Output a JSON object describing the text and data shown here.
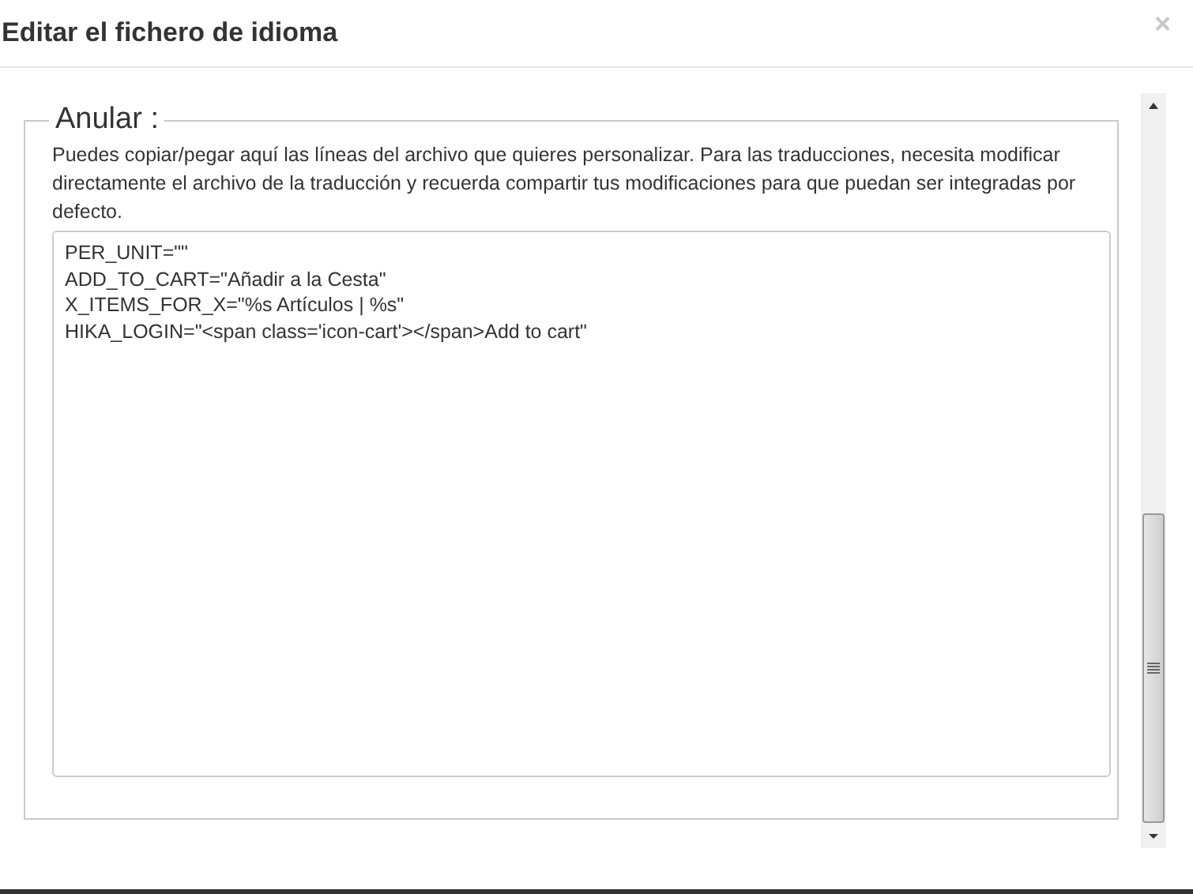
{
  "dialog": {
    "title": "Editar el fichero de idioma",
    "close": "×"
  },
  "fieldset": {
    "legend": "Anular :",
    "description": "Puedes copiar/pegar aquí las líneas del archivo que quieres personalizar. Para las traducciones, necesita modificar directamente el archivo de la traducción y recuerda compartir tus modificaciones para que puedan ser integradas por defecto.",
    "lines": [
      "PER_UNIT=\"\"",
      "ADD_TO_CART=\"Añadir a la Cesta\"",
      "X_ITEMS_FOR_X=\"%s Artículos | %s\"",
      "HIKA_LOGIN=\"<span class='icon-cart'></span>Add to cart\""
    ]
  }
}
